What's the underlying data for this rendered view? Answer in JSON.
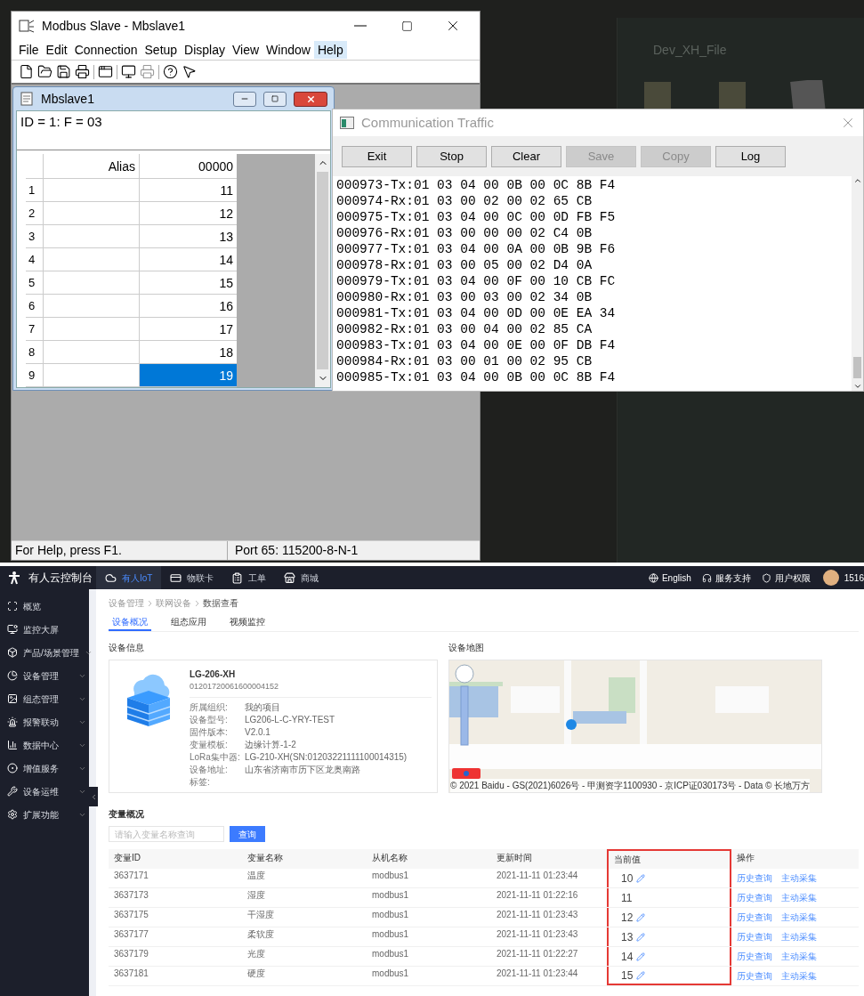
{
  "desktop": {
    "folder_title": "Dev_XH_File"
  },
  "modbus_window": {
    "title": "Modbus Slave - Mbslave1",
    "menu": [
      {
        "label": "File",
        "highlighted": false
      },
      {
        "label": "Edit",
        "highlighted": false
      },
      {
        "label": "Connection",
        "highlighted": false
      },
      {
        "label": "Setup",
        "highlighted": false
      },
      {
        "label": "Display",
        "highlighted": false
      },
      {
        "label": "View",
        "highlighted": false
      },
      {
        "label": "Window",
        "highlighted": false
      },
      {
        "label": "Help",
        "highlighted": true
      }
    ],
    "child": {
      "title": "Mbslave1",
      "header_text": "ID = 1: F = 03",
      "columns": [
        "Alias",
        "00000"
      ],
      "rows": [
        {
          "number": "1",
          "value": "11",
          "selected": false
        },
        {
          "number": "2",
          "value": "12",
          "selected": false
        },
        {
          "number": "3",
          "value": "13",
          "selected": false
        },
        {
          "number": "4",
          "value": "14",
          "selected": false
        },
        {
          "number": "5",
          "value": "15",
          "selected": false
        },
        {
          "number": "6",
          "value": "16",
          "selected": false
        },
        {
          "number": "7",
          "value": "17",
          "selected": false
        },
        {
          "number": "8",
          "value": "18",
          "selected": false
        },
        {
          "number": "9",
          "value": "19",
          "selected": true
        }
      ]
    },
    "status_bar": [
      "For Help, press F1.",
      "Port 65: 115200-8-N-1"
    ]
  },
  "traffic_window": {
    "title": "Communication Traffic",
    "buttons": [
      {
        "label": "Exit",
        "disabled": false
      },
      {
        "label": "Stop",
        "disabled": false
      },
      {
        "label": "Clear",
        "disabled": false
      },
      {
        "label": "Save",
        "disabled": true
      },
      {
        "label": "Copy",
        "disabled": true
      },
      {
        "label": "Log",
        "disabled": false
      }
    ],
    "lines": [
      "000973-Tx:01 03 04 00 0B 00 0C 8B F4",
      "000974-Rx:01 03 00 02 00 02 65 CB",
      "000975-Tx:01 03 04 00 0C 00 0D FB F5",
      "000976-Rx:01 03 00 00 00 02 C4 0B",
      "000977-Tx:01 03 04 00 0A 00 0B 9B F6",
      "000978-Rx:01 03 00 05 00 02 D4 0A",
      "000979-Tx:01 03 04 00 0F 00 10 CB FC",
      "000980-Rx:01 03 00 03 00 02 34 0B",
      "000981-Tx:01 03 04 00 0D 00 0E EA 34",
      "000982-Rx:01 03 00 04 00 02 85 CA",
      "000983-Tx:01 03 04 00 0E 00 0F DB F4",
      "000984-Rx:01 03 00 01 00 02 95 CB",
      "000985-Tx:01 03 04 00 0B 00 0C 8B F4"
    ]
  },
  "console": {
    "brand": "有人云控制台",
    "top_nav": [
      {
        "label": "有人IoT",
        "selected": true
      },
      {
        "label": "物联卡",
        "selected": false
      },
      {
        "label": "工单",
        "selected": false
      },
      {
        "label": "商城",
        "selected": false
      }
    ],
    "top_right": [
      {
        "kind": "language",
        "label": "English"
      },
      {
        "kind": "support",
        "label": "服务支持"
      },
      {
        "kind": "permission",
        "label": "用户权限"
      }
    ],
    "user": "1516",
    "sidebar": [
      {
        "label": "概览",
        "has_children": false
      },
      {
        "label": "监控大屏",
        "has_children": false
      },
      {
        "label": "产品/场景管理",
        "has_children": true
      },
      {
        "label": "设备管理",
        "has_children": true
      },
      {
        "label": "组态管理",
        "has_children": true
      },
      {
        "label": "报警联动",
        "has_children": true
      },
      {
        "label": "数据中心",
        "has_children": true
      },
      {
        "label": "增值服务",
        "has_children": true
      },
      {
        "label": "设备运维",
        "has_children": true
      },
      {
        "label": "扩展功能",
        "has_children": true
      }
    ],
    "breadcrumb": [
      "设备管理",
      "联网设备",
      "数据查看"
    ],
    "tabs": [
      {
        "label": "设备概况",
        "selected": true
      },
      {
        "label": "组态应用",
        "selected": false
      },
      {
        "label": "视频监控",
        "selected": false
      }
    ],
    "device_info": {
      "heading": "设备信息",
      "name": "LG-206-XH",
      "serial": "01201720061600004152",
      "fields": [
        {
          "label": "所属组织:",
          "value": "我的项目"
        },
        {
          "label": "设备型号:",
          "value": "LG206-L-C-YRY-TEST"
        },
        {
          "label": "固件版本:",
          "value": "V2.0.1"
        },
        {
          "label": "变量模板:",
          "value": "边缘计算-1-2"
        },
        {
          "label": "LoRa集中器:",
          "value": "LG-210-XH(SN:01203221111100014315)"
        },
        {
          "label": "设备地址:",
          "value": "山东省济南市历下区龙奥南路"
        },
        {
          "label": "标签:"
        }
      ]
    },
    "map": {
      "heading": "设备地图",
      "copyright": "© 2021 Baidu - GS(2021)6026号 - 甲测资字1100930 - 京ICP证030173号 - Data © 长地万方"
    },
    "variables": {
      "heading": "变量概况",
      "search_placeholder": "请输入变量名称查询",
      "search_button": "查询",
      "columns": [
        {
          "label": "变量ID",
          "highlighted": false
        },
        {
          "label": "变量名称",
          "highlighted": false
        },
        {
          "label": "从机名称",
          "highlighted": false
        },
        {
          "label": "更新时间",
          "highlighted": false
        },
        {
          "label": "当前值",
          "highlighted": true
        },
        {
          "label": "操作",
          "highlighted": false
        }
      ],
      "rows": [
        {
          "id": "3637171",
          "name": "温度",
          "slave": "modbus1",
          "time": "2021-11-11 01:23:44",
          "value": "10",
          "editable": true,
          "actions": [
            "历史查询",
            "主动采集"
          ]
        },
        {
          "id": "3637173",
          "name": "湿度",
          "slave": "modbus1",
          "time": "2021-11-11 01:22:16",
          "value": "11",
          "editable": false,
          "actions": [
            "历史查询",
            "主动采集"
          ]
        },
        {
          "id": "3637175",
          "name": "干湿度",
          "slave": "modbus1",
          "time": "2021-11-11 01:23:43",
          "value": "12",
          "editable": true,
          "actions": [
            "历史查询",
            "主动采集"
          ]
        },
        {
          "id": "3637177",
          "name": "柔软度",
          "slave": "modbus1",
          "time": "2021-11-11 01:23:43",
          "value": "13",
          "editable": true,
          "actions": [
            "历史查询",
            "主动采集"
          ]
        },
        {
          "id": "3637179",
          "name": "光度",
          "slave": "modbus1",
          "time": "2021-11-11 01:22:27",
          "value": "14",
          "editable": true,
          "actions": [
            "历史查询",
            "主动采集"
          ]
        },
        {
          "id": "3637181",
          "name": "硬度",
          "slave": "modbus1",
          "time": "2021-11-11 01:23:44",
          "value": "15",
          "editable": true,
          "actions": [
            "历史查询",
            "主动采集"
          ]
        }
      ]
    }
  }
}
